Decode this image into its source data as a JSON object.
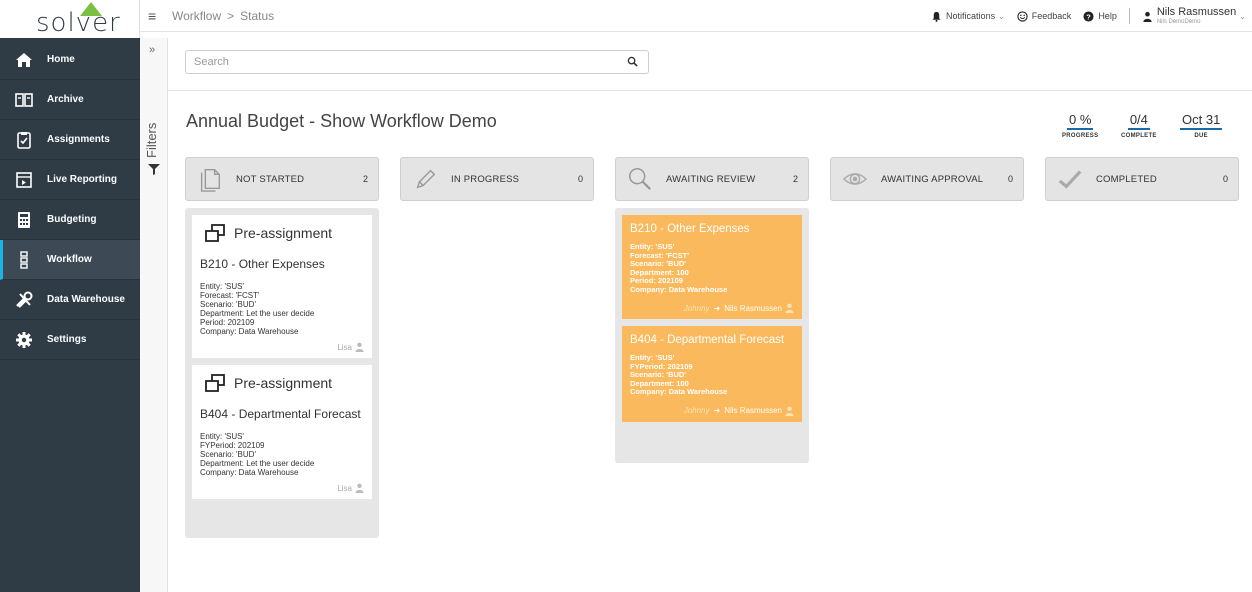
{
  "app": {
    "logo_text": "solver",
    "brand_color": "#7bc043",
    "sidebar_bg": "#2f3b45",
    "accent": "#19b5e5"
  },
  "sidebar": {
    "items": [
      {
        "label": "Home",
        "icon": "home-icon"
      },
      {
        "label": "Archive",
        "icon": "archive-icon"
      },
      {
        "label": "Assignments",
        "icon": "clipboard-icon"
      },
      {
        "label": "Live Reporting",
        "icon": "report-icon"
      },
      {
        "label": "Budgeting",
        "icon": "calculator-icon"
      },
      {
        "label": "Workflow",
        "icon": "workflow-icon",
        "active": true
      },
      {
        "label": "Data Warehouse",
        "icon": "tools-icon"
      },
      {
        "label": "Settings",
        "icon": "gear-icon"
      }
    ]
  },
  "filters": {
    "expand": "»",
    "label": "Filters"
  },
  "topbar": {
    "breadcrumb": [
      "Workflow",
      "Status"
    ],
    "breadcrumb_sep": ">",
    "notifications": "Notifications",
    "feedback": "Feedback",
    "help": "Help",
    "user_name": "Nils Rasmussen",
    "user_sub": "Nils DemoDemo"
  },
  "search": {
    "placeholder": "Search"
  },
  "page": {
    "title": "Annual Budget - Show Workflow Demo",
    "stats": [
      {
        "value": "0 %",
        "label": "PROGRESS"
      },
      {
        "value": "0/4",
        "label": "COMPLETE"
      },
      {
        "value": "Oct 31",
        "label": "DUE"
      }
    ]
  },
  "columns": [
    {
      "label": "NOT STARTED",
      "count": "2",
      "icon": "document-icon"
    },
    {
      "label": "IN PROGRESS",
      "count": "0",
      "icon": "pencil-icon"
    },
    {
      "label": "AWAITING REVIEW",
      "count": "2",
      "icon": "magnifier-icon"
    },
    {
      "label": "AWAITING APPROVAL",
      "count": "0",
      "icon": "eye-icon"
    },
    {
      "label": "COMPLETED",
      "count": "0",
      "icon": "checkmark-icon"
    }
  ],
  "not_started_cards": [
    {
      "pre": "Pre-assignment",
      "title": "B210 - Other Expenses",
      "lines": [
        "Entity: 'SUS'",
        "Forecast: 'FCST'",
        "Scenario: 'BUD'",
        "Department: Let the user decide",
        "Period: 202109",
        "Company: Data Warehouse"
      ],
      "assignee": "Lisa"
    },
    {
      "pre": "Pre-assignment",
      "title": "B404 - Departmental Forecast",
      "lines": [
        "Entity: 'SUS'",
        "FYPeriod: 202109",
        "Scenario: 'BUD'",
        "Department: Let the user decide",
        "Company: Data Warehouse"
      ],
      "assignee": "Lisa"
    }
  ],
  "review_cards": [
    {
      "title": "B210 - Other Expenses",
      "lines": [
        "Entity: 'SUS'",
        "Forecast: 'FCST'",
        "Scenario: 'BUD'",
        "Department: 100",
        "Period: 202109",
        "Company: Data Warehouse"
      ],
      "from": "Johnny",
      "arrow": "➜",
      "to": "Nils Rasmussen"
    },
    {
      "title": "B404 - Departmental Forecast",
      "lines": [
        "Entity: 'SUS'",
        "FYPeriod: 202109",
        "Scenario: 'BUD'",
        "Department: 100",
        "Company: Data Warehouse"
      ],
      "from": "Johnny",
      "arrow": "➜",
      "to": "Nils Rasmussen"
    }
  ]
}
